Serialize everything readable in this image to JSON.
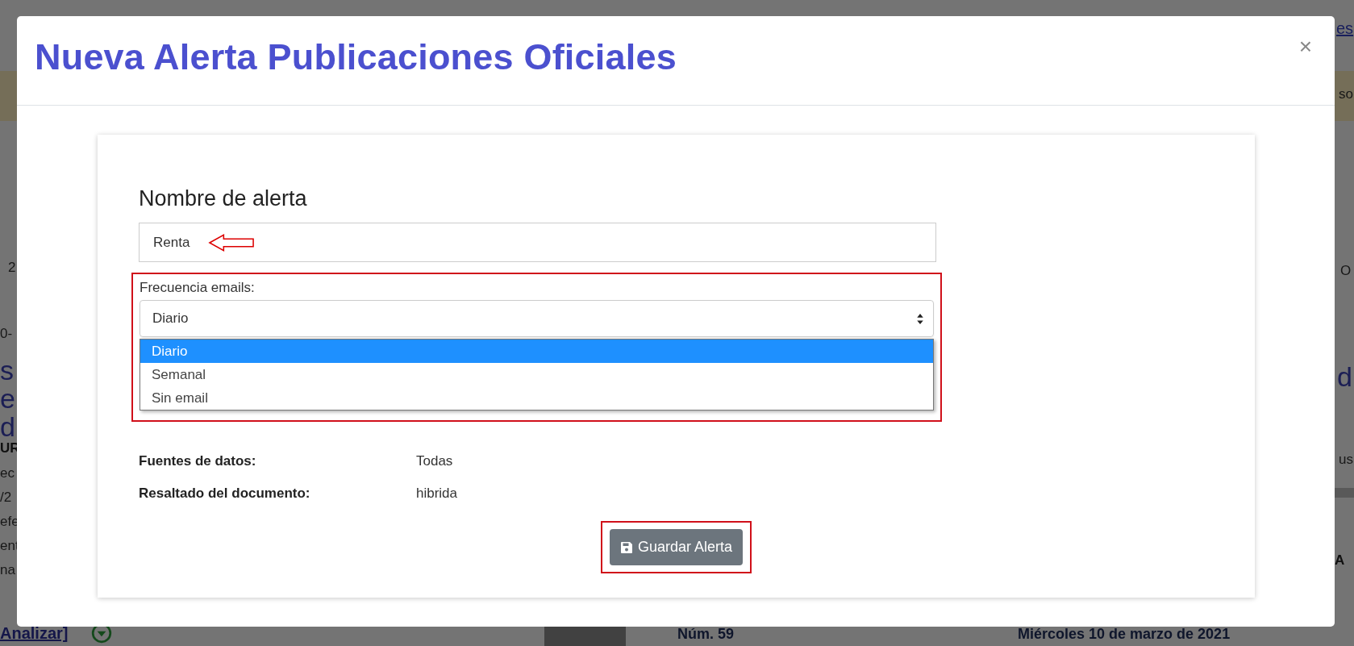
{
  "background_page": {
    "top_link": "es",
    "left_fragments": [
      {
        "text": "2",
        "kind": "plain"
      },
      {
        "text": "0-",
        "kind": "plain"
      },
      {
        "text": "s",
        "kind": "heading"
      },
      {
        "text": "e",
        "kind": "heading"
      },
      {
        "text": "d",
        "kind": "heading"
      },
      {
        "text": "UR",
        "kind": "bold"
      },
      {
        "text": "ec",
        "kind": "plain"
      },
      {
        "text": "/2",
        "kind": "plain"
      },
      {
        "text": "efe",
        "kind": "plain"
      },
      {
        "text": "ent",
        "kind": "plain"
      },
      {
        "text": "na",
        "kind": "plain"
      }
    ],
    "right_fragments": [
      {
        "text": "so",
        "kind": "plain"
      },
      {
        "text": "O",
        "kind": "plain"
      },
      {
        "text": "d",
        "kind": "heading"
      },
      {
        "text": "us",
        "kind": "plain"
      },
      {
        "text": "A",
        "kind": "bold"
      }
    ],
    "analyze_link": "Analizar]",
    "issue_number": "Núm. 59",
    "issue_date": "Miércoles 10 de marzo de 2021"
  },
  "modal": {
    "title": "Nueva Alerta Publicaciones Oficiales",
    "close": "×",
    "form": {
      "name_label": "Nombre de alerta",
      "name_value": "Renta",
      "frequency_label": "Frecuencia emails:",
      "frequency_value": "Diario",
      "frequency_options": [
        {
          "label": "Diario",
          "selected": true
        },
        {
          "label": "Semanal",
          "selected": false
        },
        {
          "label": "Sin email",
          "selected": false
        }
      ],
      "details": [
        {
          "label": "Fuentes de datos:",
          "value": "Todas"
        },
        {
          "label": "Resaltado del documento:",
          "value": "hibrida"
        }
      ],
      "save_button": "Guardar Alerta"
    }
  }
}
